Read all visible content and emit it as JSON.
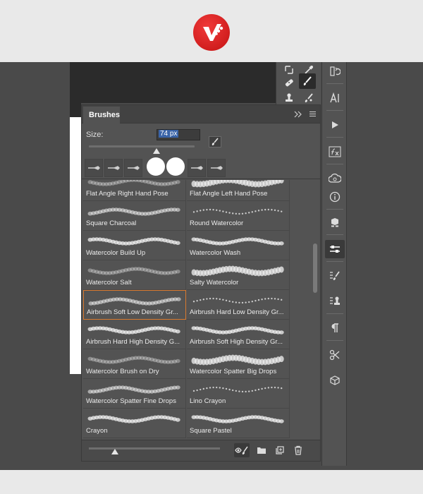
{
  "panel": {
    "tab_label": "Brushes",
    "size_label": "Size:",
    "size_value": "74 px",
    "size_slider_fraction": 0.64,
    "preview_slider_fraction": 0.2
  },
  "recent_brushes": [
    "calligraphic-brush-icon",
    "calligraphic-brush-icon",
    "calligraphic-brush-icon",
    "round-brush-icon",
    "round-brush-icon",
    "calligraphic-brush-icon",
    "calligraphic-brush-icon"
  ],
  "brushes": [
    {
      "name": "Flat Angle Right Hand Pose"
    },
    {
      "name": "Flat Angle Left Hand Pose"
    },
    {
      "name": "Square Charcoal"
    },
    {
      "name": "Round Watercolor"
    },
    {
      "name": "Watercolor Build Up"
    },
    {
      "name": "Watercolor Wash"
    },
    {
      "name": "Watercolor Salt"
    },
    {
      "name": "Salty Watercolor"
    },
    {
      "name": "Airbrush Soft Low Density Gr..."
    },
    {
      "name": "Airbrush Hard Low Density Gr..."
    },
    {
      "name": "Airbrush Hard High Density G..."
    },
    {
      "name": "Airbrush Soft High Density Gr..."
    },
    {
      "name": "Watercolor Brush on Dry"
    },
    {
      "name": "Watercolor Spatter Big Drops"
    },
    {
      "name": "Watercolor Spatter Fine Drops"
    },
    {
      "name": "Lino Crayon"
    },
    {
      "name": "Crayon"
    },
    {
      "name": "Square Pastel"
    }
  ],
  "selected_brush": "Airbrush Soft Low Density Gr...",
  "icons": {
    "tools": [
      "marquee-icon",
      "eyedropper-icon",
      "healing-icon",
      "brush-icon",
      "stamp-icon",
      "mixer-brush-icon"
    ],
    "strip": [
      "history-icon",
      "character-icon",
      "play-icon",
      "fx-icon",
      "libraries-icon",
      "info-icon",
      "3d-icon",
      "brush-settings-icon",
      "brushes-icon",
      "clone-source-icon",
      "paragraph-icon",
      "tool-presets-icon",
      "cube-icon"
    ],
    "footer": [
      "toggle-brush-preview-icon",
      "new-group-icon",
      "new-brush-icon",
      "delete-icon"
    ]
  },
  "colors": {
    "accent_selection": "#d97a2f",
    "logo_red": "#d91a1a",
    "panel_bg": "#535353"
  }
}
